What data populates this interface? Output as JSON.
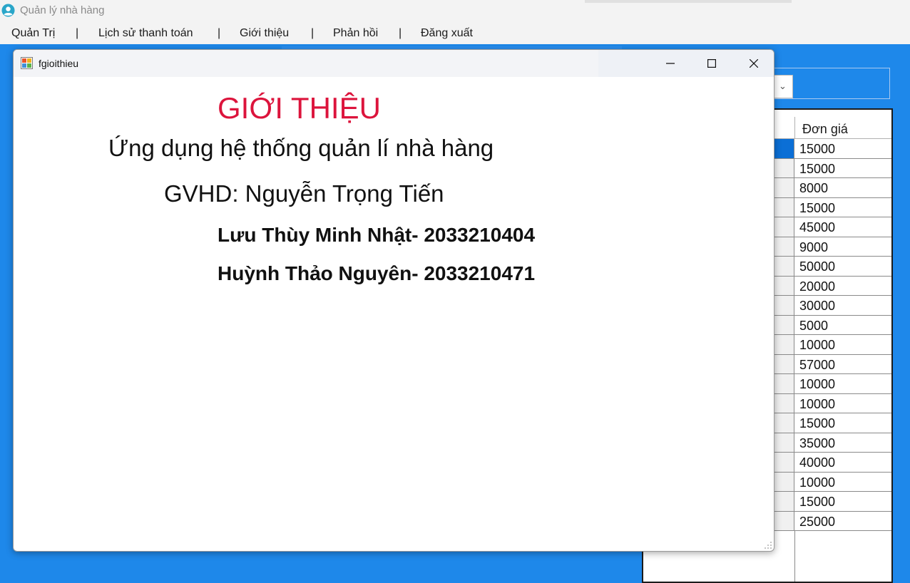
{
  "window": {
    "title": "Quản lý nhà hàng"
  },
  "menu": {
    "items": [
      "Quản Trị",
      "Lịch sử thanh toán",
      "Giới thiệu",
      "Phản hồi",
      "Đăng xuất"
    ],
    "separator": "|"
  },
  "grid": {
    "header": "Đơn giá",
    "selected_row": 0,
    "prices": [
      "15000",
      "15000",
      "8000",
      "15000",
      "45000",
      "9000",
      "50000",
      "20000",
      "30000",
      "5000",
      "10000",
      "57000",
      "10000",
      "10000",
      "15000",
      "35000",
      "40000",
      "10000",
      "15000",
      "25000"
    ]
  },
  "dialog": {
    "title": "fgioithieu",
    "heading": "GIỚI THIỆU",
    "subtitle": "Ứng dụng hệ thống quản lí nhà hàng",
    "advisor": "GVHD: Nguyễn Trọng Tiến",
    "students": [
      "Lưu Thùy Minh Nhật- 2033210404",
      "Huỳnh Thảo Nguyên- 2033210471"
    ]
  },
  "colors": {
    "mdi_background": "#1e88ea",
    "heading": "#dc143c",
    "selection": "#0b6fd6"
  },
  "icons": {
    "app": "user-circle-icon",
    "dialog": "form-window-icon",
    "minimize": "minimize-icon",
    "maximize": "maximize-icon",
    "close": "close-icon",
    "combo": "chevron-down-icon"
  }
}
